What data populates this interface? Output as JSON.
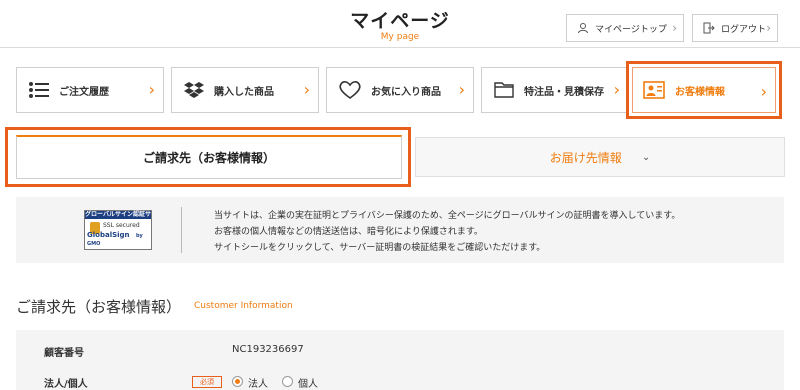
{
  "header": {
    "title": "マイページ",
    "subtitle": "My page",
    "mypage_top_label": "マイページトップ",
    "logout_label": "ログアウト"
  },
  "nav": {
    "items": [
      {
        "label": "ご注文履歴",
        "icon": "list-icon"
      },
      {
        "label": "購入した商品",
        "icon": "dropbox-icon"
      },
      {
        "label": "お気に入り商品",
        "icon": "heart-icon"
      },
      {
        "label": "特注品・見積保存",
        "icon": "folder-icon"
      },
      {
        "label": "お客様情報",
        "icon": "profile-card-icon",
        "selected": true
      }
    ]
  },
  "tabs": {
    "active": "ご請求先（お客様情報）",
    "other": "お届け先情報"
  },
  "notice": {
    "seal_top": "グローバルサイン認証サイト",
    "seal_mid": "SSL secured",
    "seal_brand": "GlobalSign",
    "seal_gmo": "by GMO",
    "lines": [
      "当サイトは、企業の実在証明とプライバシー保護のため、全ページにグローバルサインの証明書を導入しています。",
      "お客様の個人情報などの情送送信は、暗号化により保護されます。",
      "サイトシールをクリックして、サーバー証明書の検証結果をご確認いただけます。"
    ]
  },
  "section": {
    "title": "ご請求先（お客様情報）",
    "subtitle": "Customer Information"
  },
  "form": {
    "customer_no_label": "顧客番号",
    "customer_no_value": "NC193236697",
    "type_label": "法人/個人",
    "required_badge": "必須",
    "option_corp": "法人",
    "option_person": "個人"
  },
  "colors": {
    "accent": "#f07d10",
    "highlight": "#e85f1c"
  }
}
